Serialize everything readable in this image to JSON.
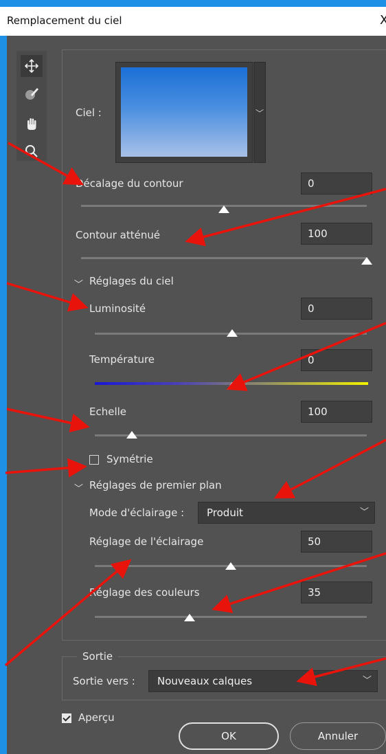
{
  "window": {
    "title": "Remplacement du ciel",
    "close_glyph": "X"
  },
  "tools": [
    {
      "name": "move-icon",
      "selected": true
    },
    {
      "name": "sky-brush-icon",
      "selected": false
    },
    {
      "name": "hand-icon",
      "selected": false
    },
    {
      "name": "zoom-icon",
      "selected": false
    }
  ],
  "sky": {
    "label": "Ciel :",
    "thumbnail_colors": [
      "#1b6fd6",
      "#a8c0e8"
    ]
  },
  "controls": {
    "shift_edge": {
      "label": "Décalage du contour",
      "value": "0"
    },
    "fade_edge": {
      "label": "Contour atténué",
      "value": "100"
    }
  },
  "sky_adjustments": {
    "header": "Réglages du ciel",
    "brightness": {
      "label": "Luminosité",
      "value": "0"
    },
    "temperature": {
      "label": "Température",
      "value": "0"
    },
    "scale": {
      "label": "Echelle",
      "value": "100"
    },
    "flip": {
      "label": "Symétrie",
      "checked": false
    }
  },
  "foreground_adjustments": {
    "header": "Réglages de premier plan",
    "lighting_mode": {
      "label": "Mode d'éclairage :",
      "value": "Produit"
    },
    "lighting_adjustment": {
      "label": "Réglage de l'éclairage",
      "value": "50"
    },
    "color_adjustment": {
      "label": "Réglage des couleurs",
      "value": "35"
    }
  },
  "output": {
    "group_title": "Sortie",
    "label": "Sortie vers :",
    "value": "Nouveaux calques"
  },
  "footer": {
    "preview_label": "Aperçu",
    "preview_checked": true,
    "ok_label": "OK",
    "cancel_label": "Annuler"
  },
  "colors": {
    "background": "#1e90e6",
    "dialog": "#525252",
    "annotation_arrow": "#e8140c"
  }
}
